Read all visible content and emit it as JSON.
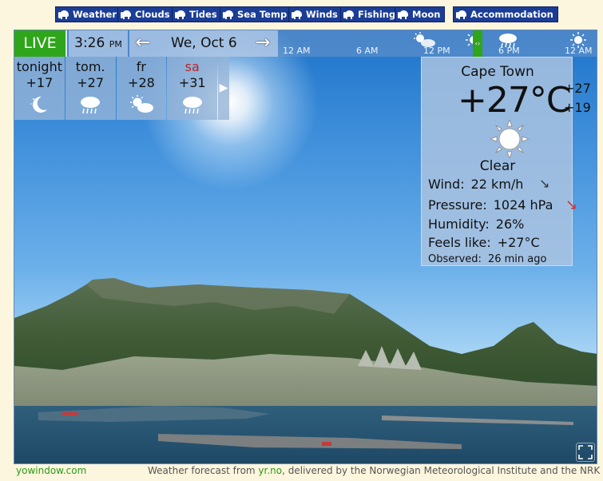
{
  "nav": [
    {
      "label": "Weather",
      "icon": "elephant-icon"
    },
    {
      "label": "Clouds",
      "icon": "elephant-icon"
    },
    {
      "label": "Tides",
      "icon": "elephant-icon"
    },
    {
      "label": "Sea Temp",
      "icon": "elephant-icon"
    },
    {
      "label": "Winds",
      "icon": "elephant-icon"
    },
    {
      "label": "Fishing",
      "icon": "elephant-icon"
    },
    {
      "label": "Moon",
      "icon": "elephant-icon"
    },
    {
      "label": "Accommodation",
      "icon": "elephant-icon"
    }
  ],
  "topbar": {
    "live": "LIVE",
    "time": "3:26",
    "ampm": "PM",
    "date": "We, Oct 6",
    "prev_icon": "left-arrow-icon",
    "next_icon": "right-arrow-icon"
  },
  "timeline": {
    "labels": [
      "12 AM",
      "6 AM",
      "12 PM",
      "6 PM",
      "12 AM"
    ],
    "icons": [
      "partly-cloudy-icon",
      "sun-icon",
      "rain-cloud-icon",
      "sun-icon"
    ],
    "marker_icon": "timeline-marker-icon"
  },
  "forecast": [
    {
      "name": "tonight",
      "temp": "+17",
      "icon": "moon-icon",
      "weekend": false
    },
    {
      "name": "tom.",
      "temp": "+27",
      "icon": "rain-cloud-icon",
      "weekend": false
    },
    {
      "name": "fr",
      "temp": "+28",
      "icon": "partly-cloudy-icon",
      "weekend": false
    },
    {
      "name": "sa",
      "temp": "+31",
      "icon": "rain-cloud-icon",
      "weekend": true
    }
  ],
  "current": {
    "city": "Cape Town",
    "temp": "+27°C",
    "hi": "+27",
    "lo": "+19",
    "condition": "Clear",
    "condition_icon": "sun-icon",
    "wind_label": "Wind:",
    "wind_value": "22 km/h",
    "wind_arrow": "↘",
    "pressure_label": "Pressure:",
    "pressure_value": "1024 hPa",
    "pressure_arrow": "↘",
    "humidity_label": "Humidity:",
    "humidity_value": "26%",
    "feels_label": "Feels like:",
    "feels_value": "+27°C",
    "observed_label": "Observed:",
    "observed_value": "26 min ago"
  },
  "footer": {
    "link": "yowindow.com",
    "credit_pre": "Weather forecast from ",
    "credit_link": "yr.no",
    "credit_post": ", delivered by the Norwegian Meteorological Institute and the NRK"
  },
  "colors": {
    "nav_button": "#1b3d96",
    "live": "#2fa51c",
    "weekend": "#c42020",
    "link": "#2a9a17",
    "page_background": "#fdf6de"
  }
}
